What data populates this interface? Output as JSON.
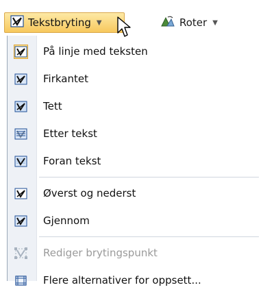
{
  "ribbon": {
    "wrap_label": "Tekstbryting",
    "rotate_label": "Roter"
  },
  "menu": {
    "items": [
      {
        "name": "inline-with-text",
        "label": "På linje med teksten",
        "icon": "wrap-inline-icon",
        "state": "selected"
      },
      {
        "name": "square",
        "label": "Firkantet",
        "icon": "wrap-square-icon",
        "state": "normal"
      },
      {
        "name": "tight",
        "label": "Tett",
        "icon": "wrap-tight-icon",
        "state": "normal"
      },
      {
        "name": "behind-text",
        "label": "Etter tekst",
        "icon": "wrap-behind-text-icon",
        "state": "normal"
      },
      {
        "name": "in-front-of-text",
        "label": "Foran tekst",
        "icon": "wrap-in-front-icon",
        "state": "normal"
      },
      {
        "name": "top-and-bottom",
        "label": "Øverst og nederst",
        "icon": "wrap-top-bottom-icon",
        "state": "normal"
      },
      {
        "name": "through",
        "label": "Gjennom",
        "icon": "wrap-through-icon",
        "state": "normal"
      },
      {
        "name": "edit-wrap-points",
        "label": "Rediger brytingspunkt",
        "icon": "edit-wrap-points-icon",
        "state": "disabled"
      },
      {
        "name": "more-layout-options",
        "label": "Flere alternativer for oppsett...",
        "icon": "more-layout-options-icon",
        "state": "normal"
      }
    ]
  },
  "colors": {
    "highlight": "#f7c85d",
    "menu_gutter": "#eef1f6",
    "icon_blue": "#1f4e96",
    "disabled_text": "#9a9a9a"
  }
}
